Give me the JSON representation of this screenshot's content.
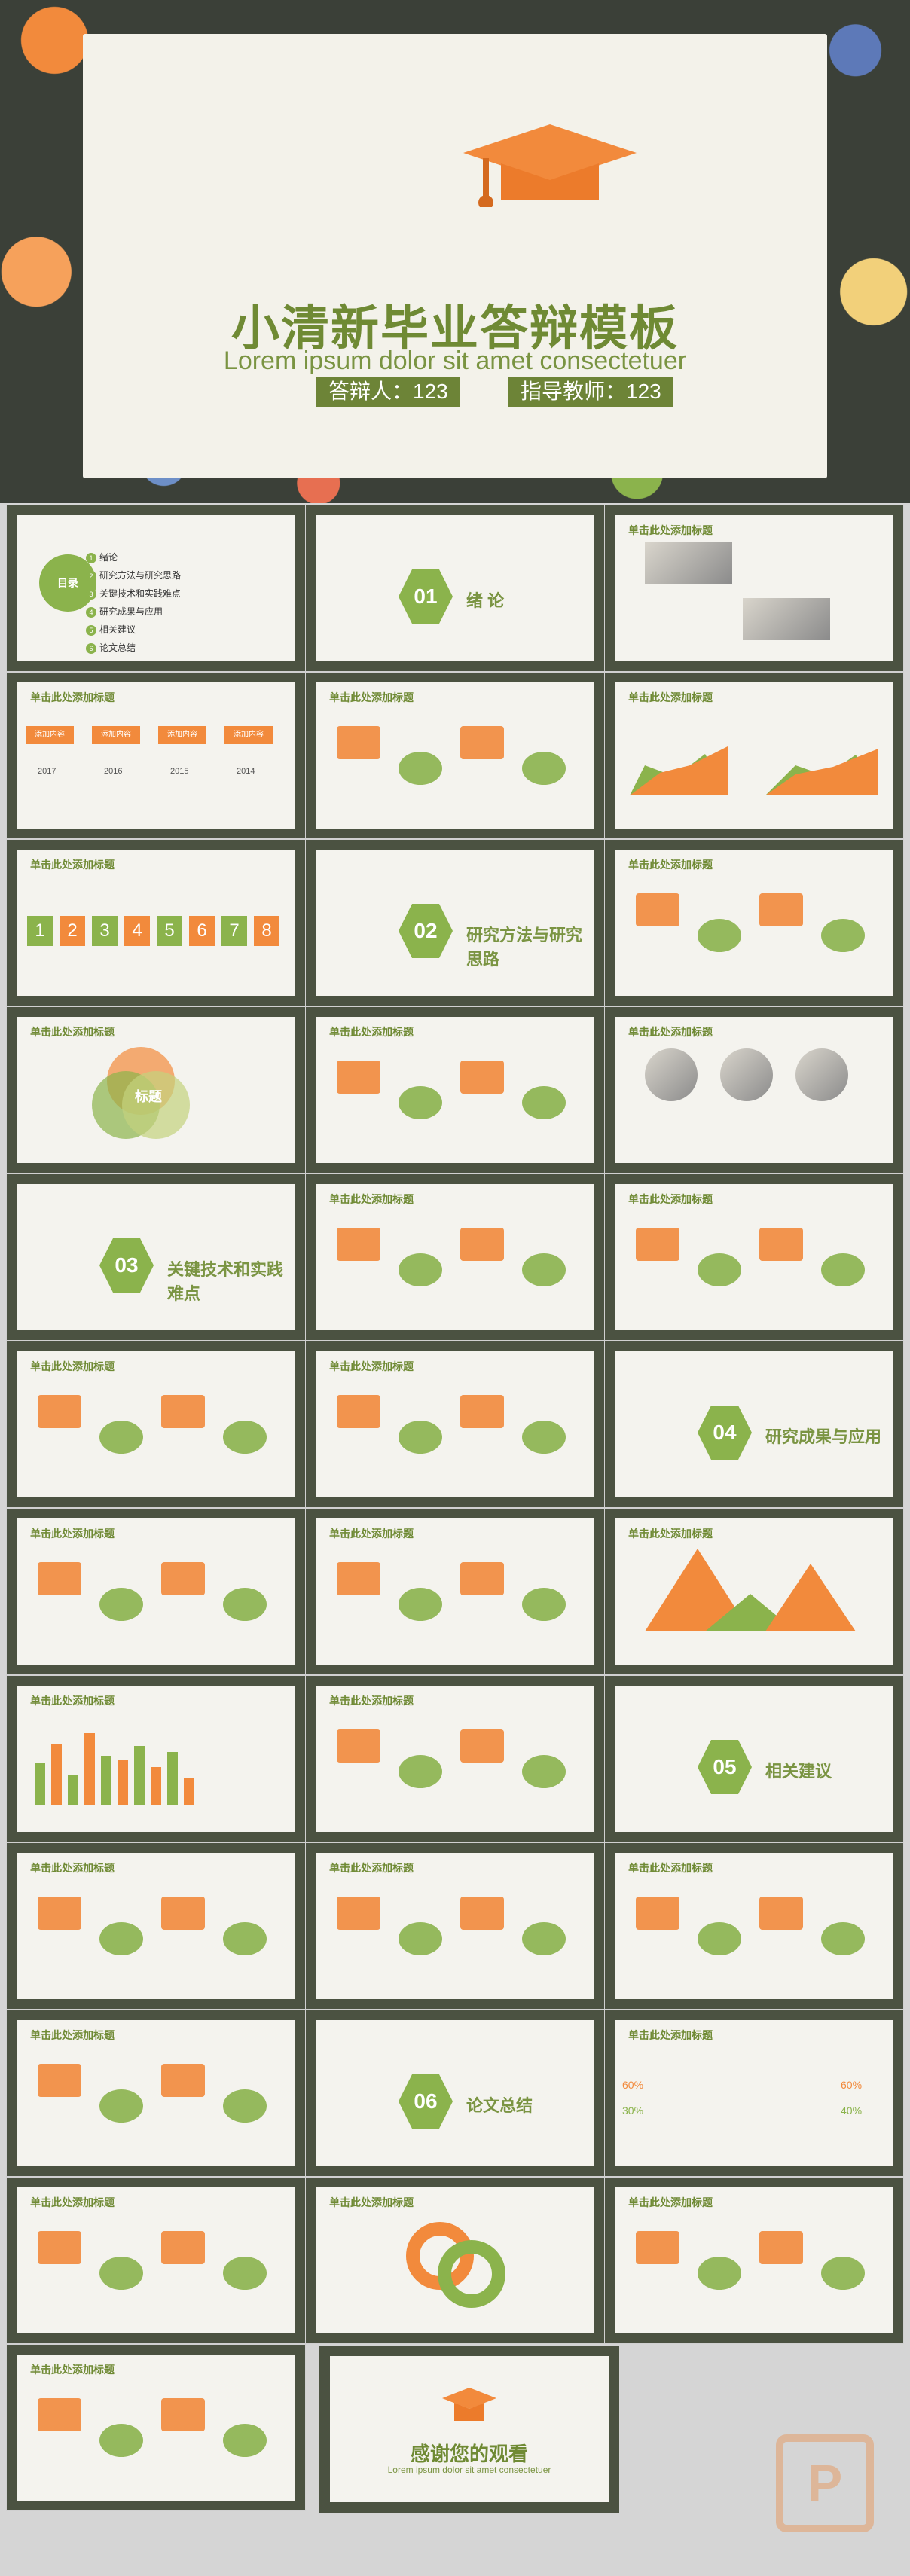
{
  "hero": {
    "title": "小清新毕业答辩模板",
    "subtitle": "Lorem ipsum dolor sit amet consectetuer",
    "presenter": "答辩人：123",
    "advisor": "指导教师：123"
  },
  "slides": [
    {
      "title": "",
      "kind": "toc",
      "items": [
        "绪论",
        "研究方法与研究思路",
        "关键技术和实践难点",
        "研究成果与应用",
        "相关建议",
        "论文总结"
      ],
      "center": "目录"
    },
    {
      "title": "",
      "kind": "section",
      "number": "01",
      "text": "绪 论"
    },
    {
      "title": "单击此处添加标题",
      "kind": "photos"
    },
    {
      "title": "单击此处添加标题",
      "kind": "years",
      "labels": [
        "添加内容",
        "添加内容",
        "添加内容",
        "添加内容"
      ],
      "years": [
        "2017",
        "2016",
        "2015",
        "2014"
      ]
    },
    {
      "title": "单击此处添加标题",
      "kind": "list"
    },
    {
      "title": "单击此处添加标题",
      "kind": "area"
    },
    {
      "title": "单击此处添加标题",
      "kind": "steps",
      "numbers": [
        "1",
        "2",
        "3",
        "4",
        "5",
        "6",
        "7",
        "8"
      ]
    },
    {
      "title": "",
      "kind": "section",
      "number": "02",
      "text": "研究方法与研究思路"
    },
    {
      "title": "单击此处添加标题",
      "kind": "china"
    },
    {
      "title": "单击此处添加标题",
      "kind": "venn",
      "center": "标题"
    },
    {
      "title": "单击此处添加标题",
      "kind": "hex"
    },
    {
      "title": "单击此处添加标题",
      "kind": "portraits"
    },
    {
      "title": "",
      "kind": "section",
      "number": "03",
      "text": "关键技术和实践难点"
    },
    {
      "title": "单击此处添加标题",
      "kind": "network"
    },
    {
      "title": "单击此处添加标题",
      "kind": "org"
    },
    {
      "title": "单击此处添加标题",
      "kind": "blocks"
    },
    {
      "title": "单击此处添加标题",
      "kind": "arrows"
    },
    {
      "title": "",
      "kind": "section",
      "number": "04",
      "text": "研究成果与应用"
    },
    {
      "title": "单击此处添加标题",
      "kind": "path"
    },
    {
      "title": "单击此处添加标题",
      "kind": "timeline"
    },
    {
      "title": "单击此处添加标题",
      "kind": "peaks"
    },
    {
      "title": "单击此处添加标题",
      "kind": "bars"
    },
    {
      "title": "单击此处添加标题",
      "kind": "circles"
    },
    {
      "title": "",
      "kind": "section",
      "number": "05",
      "text": "相关建议"
    },
    {
      "title": "单击此处添加标题",
      "kind": "star"
    },
    {
      "title": "单击此处添加标题",
      "kind": "bubbles"
    },
    {
      "title": "单击此处添加标题",
      "kind": "plus"
    },
    {
      "title": "单击此处添加标题",
      "kind": "stairs"
    },
    {
      "title": "",
      "kind": "section",
      "number": "06",
      "text": "论文总结"
    },
    {
      "title": "单击此处添加标题",
      "kind": "people",
      "values": [
        "60%",
        "30%",
        "60%",
        "40%"
      ]
    },
    {
      "title": "单击此处添加标题",
      "kind": "icons"
    },
    {
      "title": "单击此处添加标题",
      "kind": "rings"
    },
    {
      "title": "单击此处添加标题",
      "kind": "brain"
    },
    {
      "title": "单击此处添加标题",
      "kind": "diamonds"
    }
  ],
  "end": {
    "title": "感谢您的观看",
    "subtitle": "Lorem ipsum dolor sit amet consectetuer"
  },
  "watermark": "P"
}
